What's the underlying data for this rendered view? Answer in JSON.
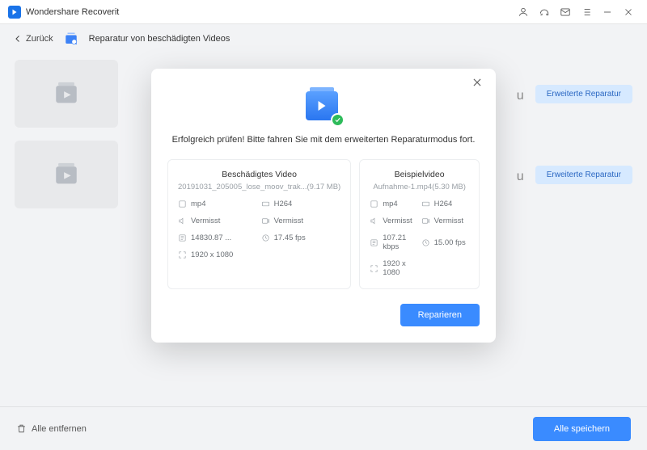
{
  "app": {
    "title": "Wondershare Recoverit"
  },
  "toolbar": {
    "back": "Zurück",
    "page_title": "Reparatur von beschädigten Videos"
  },
  "rows": {
    "preview_tip": "u",
    "advanced_label": "Erweiterte Reparatur"
  },
  "footer": {
    "remove_all": "Alle entfernen",
    "save_all": "Alle speichern"
  },
  "modal": {
    "message": "Erfolgreich prüfen! Bitte fahren Sie mit dem erweiterten Reparaturmodus fort.",
    "repair_btn": "Reparieren",
    "damaged": {
      "title": "Beschädigtes Video",
      "filename": "20191031_205005_lose_moov_trak...(9.17  MB)",
      "format": "mp4",
      "codec": "H264",
      "audio": "Vermisst",
      "remark": "Vermisst",
      "bitrate": "14830.87 ...",
      "fps": "17.45 fps",
      "res": "1920 x 1080"
    },
    "sample": {
      "title": "Beispielvideo",
      "filename": "Aufnahme-1.mp4(5.30  MB)",
      "format": "mp4",
      "codec": "H264",
      "audio": "Vermisst",
      "remark": "Vermisst",
      "bitrate": "107.21 kbps",
      "fps": "15.00 fps",
      "res": "1920 x 1080"
    }
  }
}
